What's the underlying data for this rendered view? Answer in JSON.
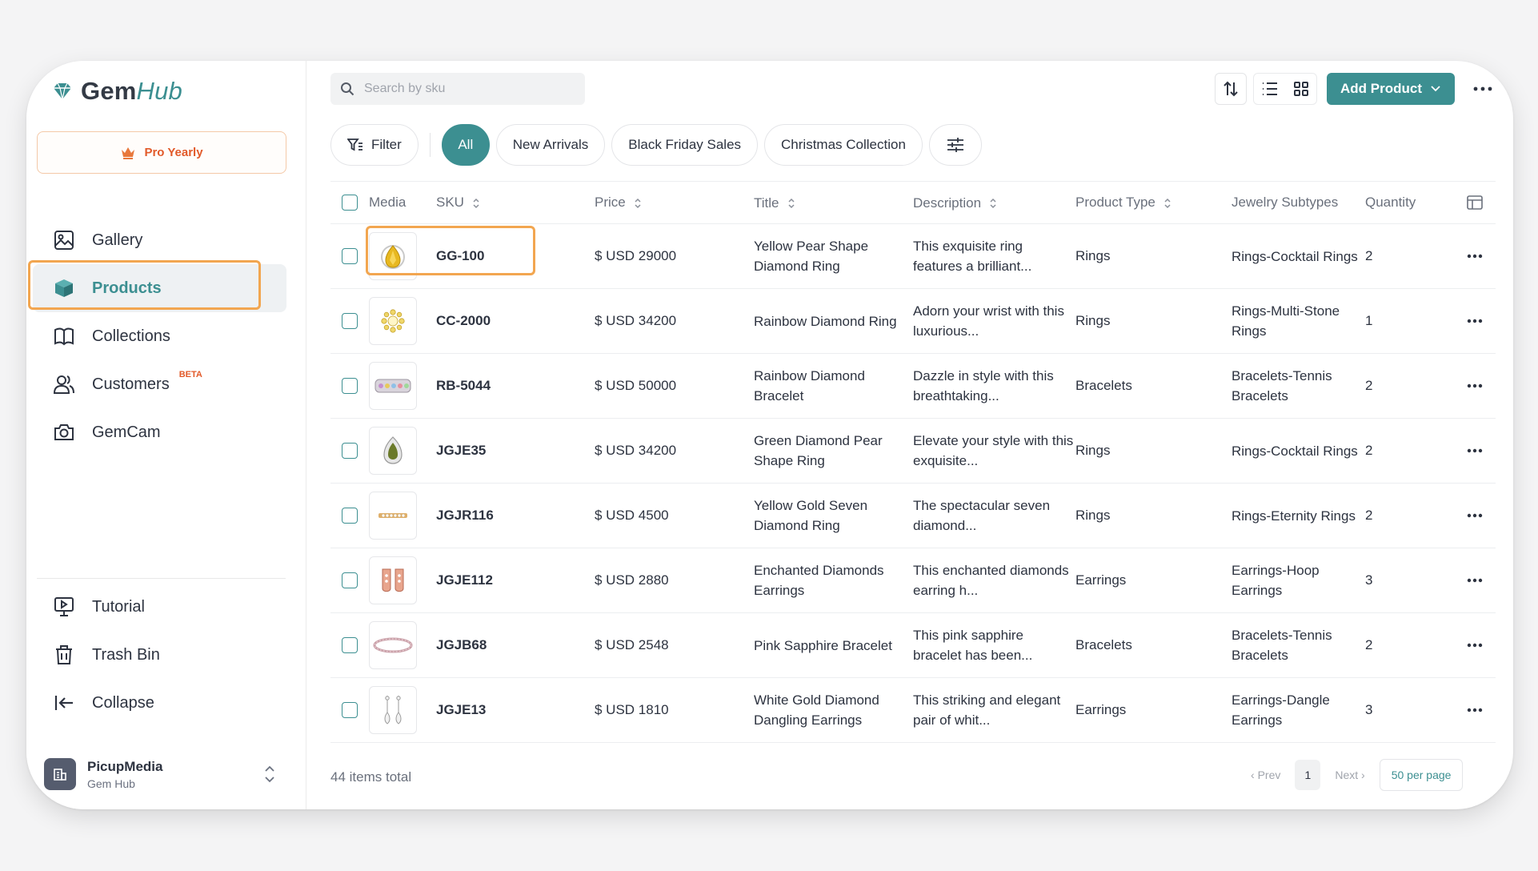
{
  "colors": {
    "accent": "#3c8f91",
    "highlight": "#f2a650",
    "pro": "#e25a2a"
  },
  "app": {
    "logo_part1": "Gem",
    "logo_part2": "Hub"
  },
  "plan": {
    "label": "Pro Yearly"
  },
  "nav": {
    "items": [
      {
        "label": "Gallery",
        "icon": "image-icon"
      },
      {
        "label": "Products",
        "icon": "box-icon",
        "active": true
      },
      {
        "label": "Collections",
        "icon": "book-icon"
      },
      {
        "label": "Customers",
        "icon": "users-icon",
        "badge": "BETA"
      },
      {
        "label": "GemCam",
        "icon": "camera-icon"
      }
    ],
    "bottom": [
      {
        "label": "Tutorial",
        "icon": "presentation-icon"
      },
      {
        "label": "Trash Bin",
        "icon": "trash-icon"
      },
      {
        "label": "Collapse",
        "icon": "collapse-icon"
      }
    ]
  },
  "account": {
    "name": "PicupMedia",
    "sub": "Gem Hub"
  },
  "search": {
    "placeholder": "Search by sku"
  },
  "toolbar": {
    "add_label": "Add Product"
  },
  "filters": {
    "filter_label": "Filter",
    "chips": [
      "All",
      "New Arrivals",
      "Black Friday Sales",
      "Christmas Collection"
    ]
  },
  "table": {
    "headers": {
      "media": "Media",
      "sku": "SKU",
      "price": "Price",
      "title": "Title",
      "description": "Description",
      "type": "Product Type",
      "subtype": "Jewelry Subtypes",
      "quantity": "Quantity"
    },
    "rows": [
      {
        "sku": "GG-100",
        "price": "$ USD 29000",
        "title": "Yellow Pear Shape Diamond Ring",
        "desc": "This exquisite ring features a brilliant...",
        "type": "Rings",
        "sub": "Rings-Cocktail Rings",
        "qty": "2",
        "thumb": "pear-ring-icon"
      },
      {
        "sku": "CC-2000",
        "price": "$ USD 34200",
        "title": "Rainbow Diamond Ring",
        "desc": "Adorn your wrist with this luxurious...",
        "type": "Rings",
        "sub": "Rings-Multi-Stone Rings",
        "qty": "1",
        "thumb": "cluster-ring-icon"
      },
      {
        "sku": "RB-5044",
        "price": "$ USD 50000",
        "title": "Rainbow Diamond Bracelet",
        "desc": "Dazzle in style with this breathtaking...",
        "type": "Bracelets",
        "sub": "Bracelets-Tennis Bracelets",
        "qty": "2",
        "thumb": "bracelet-icon"
      },
      {
        "sku": "JGJE35",
        "price": "$ USD 34200",
        "title": "Green Diamond Pear Shape Ring",
        "desc": "Elevate your style with this exquisite...",
        "type": "Rings",
        "sub": "Rings-Cocktail Rings",
        "qty": "2",
        "thumb": "green-ring-icon"
      },
      {
        "sku": "JGJR116",
        "price": "$ USD 4500",
        "title": "Yellow Gold Seven Diamond Ring",
        "desc": "The spectacular seven diamond...",
        "type": "Rings",
        "sub": "Rings-Eternity Rings",
        "qty": "2",
        "thumb": "band-ring-icon"
      },
      {
        "sku": "JGJE112",
        "price": "$ USD 2880",
        "title": "Enchanted Diamonds Earrings",
        "desc": "This enchanted diamonds earring h...",
        "type": "Earrings",
        "sub": "Earrings-Hoop Earrings",
        "qty": "3",
        "thumb": "hoop-earrings-icon"
      },
      {
        "sku": "JGJB68",
        "price": "$ USD 2548",
        "title": "Pink Sapphire Bracelet",
        "desc": "This pink sapphire bracelet has been...",
        "type": "Bracelets",
        "sub": "Bracelets-Tennis Bracelets",
        "qty": "2",
        "thumb": "pink-bracelet-icon"
      },
      {
        "sku": "JGJE13",
        "price": "$ USD 1810",
        "title": "White Gold Diamond Dangling Earrings",
        "desc": "This striking and elegant pair of whit...",
        "type": "Earrings",
        "sub": "Earrings-Dangle Earrings",
        "qty": "3",
        "thumb": "dangle-earrings-icon"
      }
    ]
  },
  "footer": {
    "total": "44 items total",
    "prev": "Prev",
    "next": "Next",
    "page": "1",
    "per_page": "50 per page"
  }
}
